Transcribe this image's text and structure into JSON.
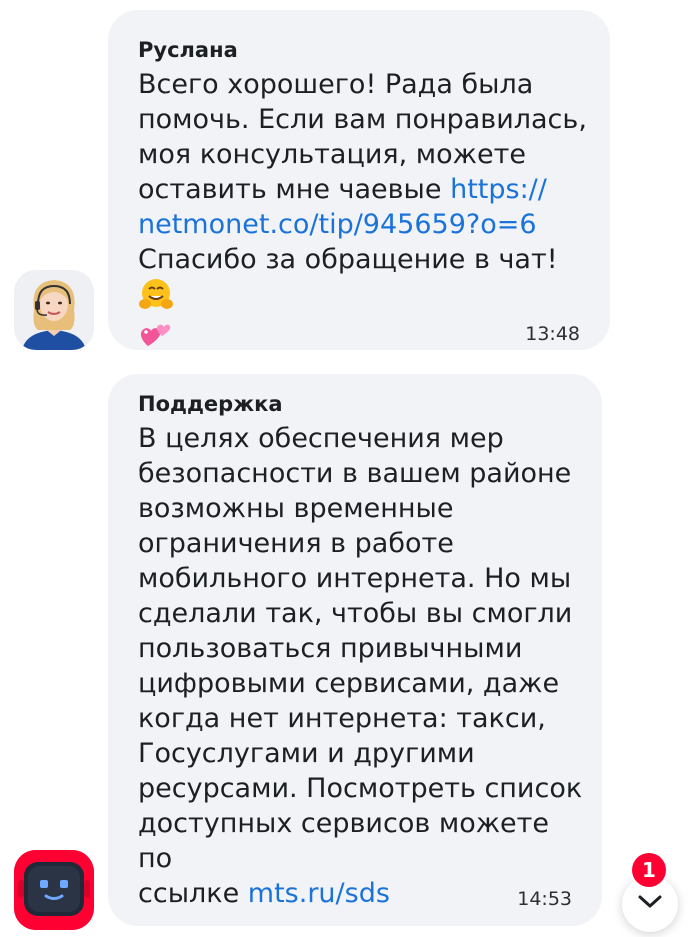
{
  "messages": [
    {
      "sender": "Руслана",
      "text_lines": [
        "Всего хорошего! Рада была",
        "помочь. Если вам понравилась,",
        "моя консультация, можете",
        "оставить мне чаевые "
      ],
      "link_line1": "https://",
      "link_line2": "netmonet.co/tip/945659?o=6",
      "text_after": "Спасибо за обращение в чат!",
      "emojis": [
        "hugging-face-emoji",
        "two-hearts-emoji"
      ],
      "time": "13:48",
      "avatar": "support-agent-avatar"
    },
    {
      "sender": "Поддержка",
      "text_lines": [
        "В целях обеспечения мер",
        "безопасности в вашем районе",
        "возможны временные",
        "ограничения в работе",
        "мобильного интернета. Но мы",
        "сделали так, чтобы вы смогли",
        "пользоваться привычными",
        "цифровыми сервисами, даже",
        "когда нет интернета: такси,",
        "Госуслугами и другими",
        "ресурсами. Посмотреть список",
        "доступных сервисов можете по",
        "ссылке "
      ],
      "link": "mts.ru/sds",
      "time": "14:53",
      "avatar": "robot-bot-avatar"
    }
  ],
  "scroll_button": {
    "icon": "chevron-down-icon",
    "unread_count": "1"
  },
  "colors": {
    "bubble": "#f2f3f7",
    "link": "#1a73d9",
    "accent": "#ff0032"
  }
}
